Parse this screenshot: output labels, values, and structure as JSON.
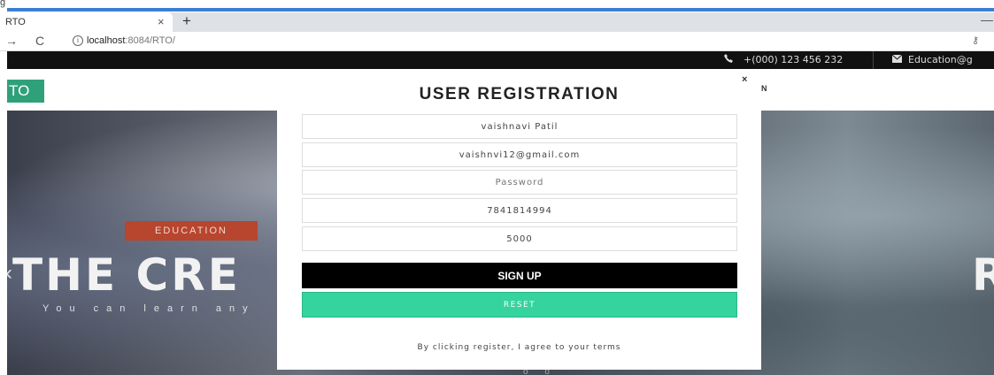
{
  "browser": {
    "corner_letter": "g",
    "tab_title": "RTO",
    "tab_close": "×",
    "new_tab": "+",
    "minimize": "—",
    "url_host": "localhost",
    "url_path": ":8084/RTO/",
    "info_icon": "i",
    "key_icon": "⚷"
  },
  "topbar": {
    "phone_icon": "phone-icon",
    "phone": "+(000) 123 456 232",
    "mail_icon": "mail-icon",
    "email": "Education@g"
  },
  "navbar": {
    "logo": "TO",
    "nav_partial": "N"
  },
  "hero": {
    "badge": "EDUCATION",
    "title_left": "THE CRE",
    "title_right": "R",
    "subtitle": "You can learn any",
    "prev_arrow": "‹"
  },
  "modal": {
    "close": "×",
    "title": "USER REGISTRATION",
    "fields": {
      "name": "vaishnavi Patil",
      "email": "vaishnvi12@gmail.com",
      "password_placeholder": "Password",
      "phone": "7841814994",
      "amount": "5000"
    },
    "signup_label": "SIGN UP",
    "reset_label": "RESET",
    "terms": "By clicking register, I agree to your terms"
  },
  "colors": {
    "logo_green": "#2fa17a",
    "badge_red": "#b8452e",
    "reset_green": "#35d39d",
    "signup_black": "#000000",
    "browser_blue": "#3b7fd4"
  }
}
